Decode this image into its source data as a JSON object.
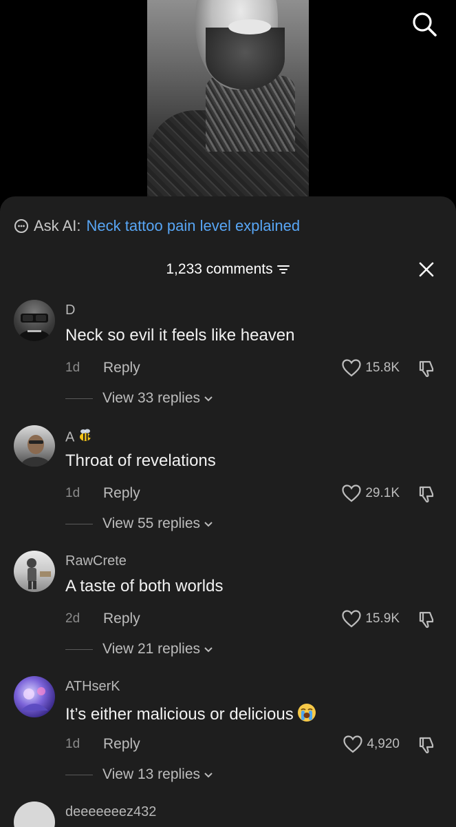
{
  "ask_ai": {
    "label": "Ask AI:",
    "query": "Neck tattoo pain level explained"
  },
  "comments_header": {
    "count_label": "1,233 comments"
  },
  "colors": {
    "sheet_bg": "#1e1e1e",
    "link_blue": "#58a6f5",
    "muted_text": "#bdbdbd"
  },
  "comments": [
    {
      "username": "D",
      "text": "Neck so evil it feels like heaven",
      "age": "1d",
      "reply_label": "Reply",
      "likes": "15.8K",
      "replies_label": "View 33 replies"
    },
    {
      "username": "A",
      "username_emoji": "bee-emoji",
      "text": "Throat of revelations",
      "age": "1d",
      "reply_label": "Reply",
      "likes": "29.1K",
      "replies_label": "View 55 replies"
    },
    {
      "username": "RawCrete",
      "text": "A taste of both worlds",
      "age": "2d",
      "reply_label": "Reply",
      "likes": "15.9K",
      "replies_label": "View 21 replies"
    },
    {
      "username": "ATHserK",
      "text": "It’s either malicious or delicious",
      "text_emoji": "loudly-crying-face-emoji",
      "age": "1d",
      "reply_label": "Reply",
      "likes": "4,920",
      "replies_label": "View 13 replies"
    }
  ],
  "partial_comment": {
    "username": "deeeeeeez432"
  }
}
